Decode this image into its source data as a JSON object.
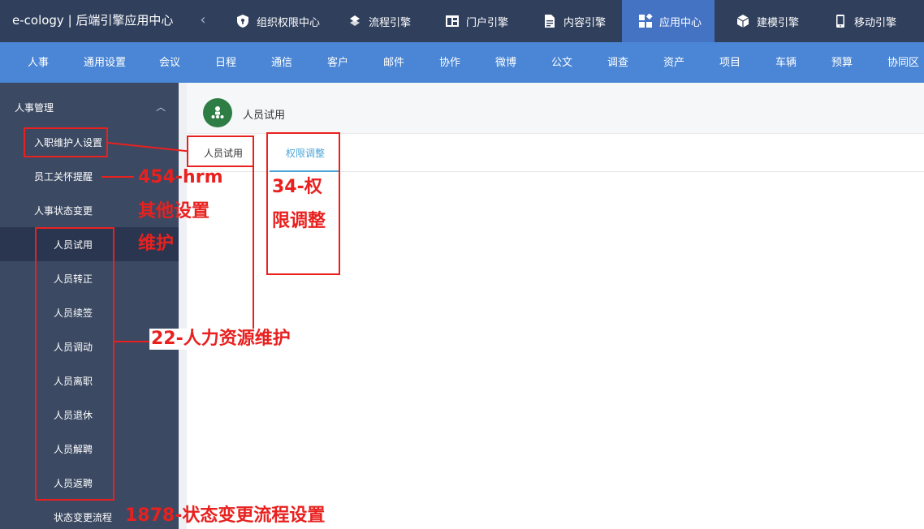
{
  "app": {
    "title": "e-cology | 后端引擎应用中心"
  },
  "engines": [
    {
      "label": "组织权限中心",
      "icon": "shield-icon"
    },
    {
      "label": "流程引擎",
      "icon": "flow-icon"
    },
    {
      "label": "门户引擎",
      "icon": "layout-icon"
    },
    {
      "label": "内容引擎",
      "icon": "document-icon"
    },
    {
      "label": "应用中心",
      "icon": "apps-icon",
      "active": true
    },
    {
      "label": "建模引擎",
      "icon": "cube-icon"
    },
    {
      "label": "移动引擎",
      "icon": "mobile-icon"
    }
  ],
  "modules": [
    "人事",
    "通用设置",
    "会议",
    "日程",
    "通信",
    "客户",
    "邮件",
    "协作",
    "微博",
    "公文",
    "调查",
    "资产",
    "项目",
    "车辆",
    "预算",
    "协同区"
  ],
  "sidebar": {
    "group": "人事管理",
    "items": [
      "入职维护人设置",
      "员工关怀提醒",
      "人事状态变更"
    ],
    "subitems": [
      "人员试用",
      "人员转正",
      "人员续签",
      "人员调动",
      "人员离职",
      "人员退休",
      "人员解聘",
      "人员返聘"
    ],
    "last": "状态变更流程"
  },
  "content": {
    "title": "人员试用",
    "tabs": [
      "人员试用",
      "权限调整"
    ]
  },
  "annotations": {
    "a1_line1": "454-hrm",
    "a1_line2": "其他设置",
    "a1_line3": "维护",
    "a2": "22-人力资源维护",
    "a3_line1": "34-权",
    "a3_line2": "限调整",
    "a4": "1878-状态变更流程设置"
  },
  "colors": {
    "topbar": "#2f3f5c",
    "modbar": "#4a86d5",
    "sidebar": "#3b4963",
    "accent": "#4ea6d8",
    "annotation": "#e8211f"
  }
}
